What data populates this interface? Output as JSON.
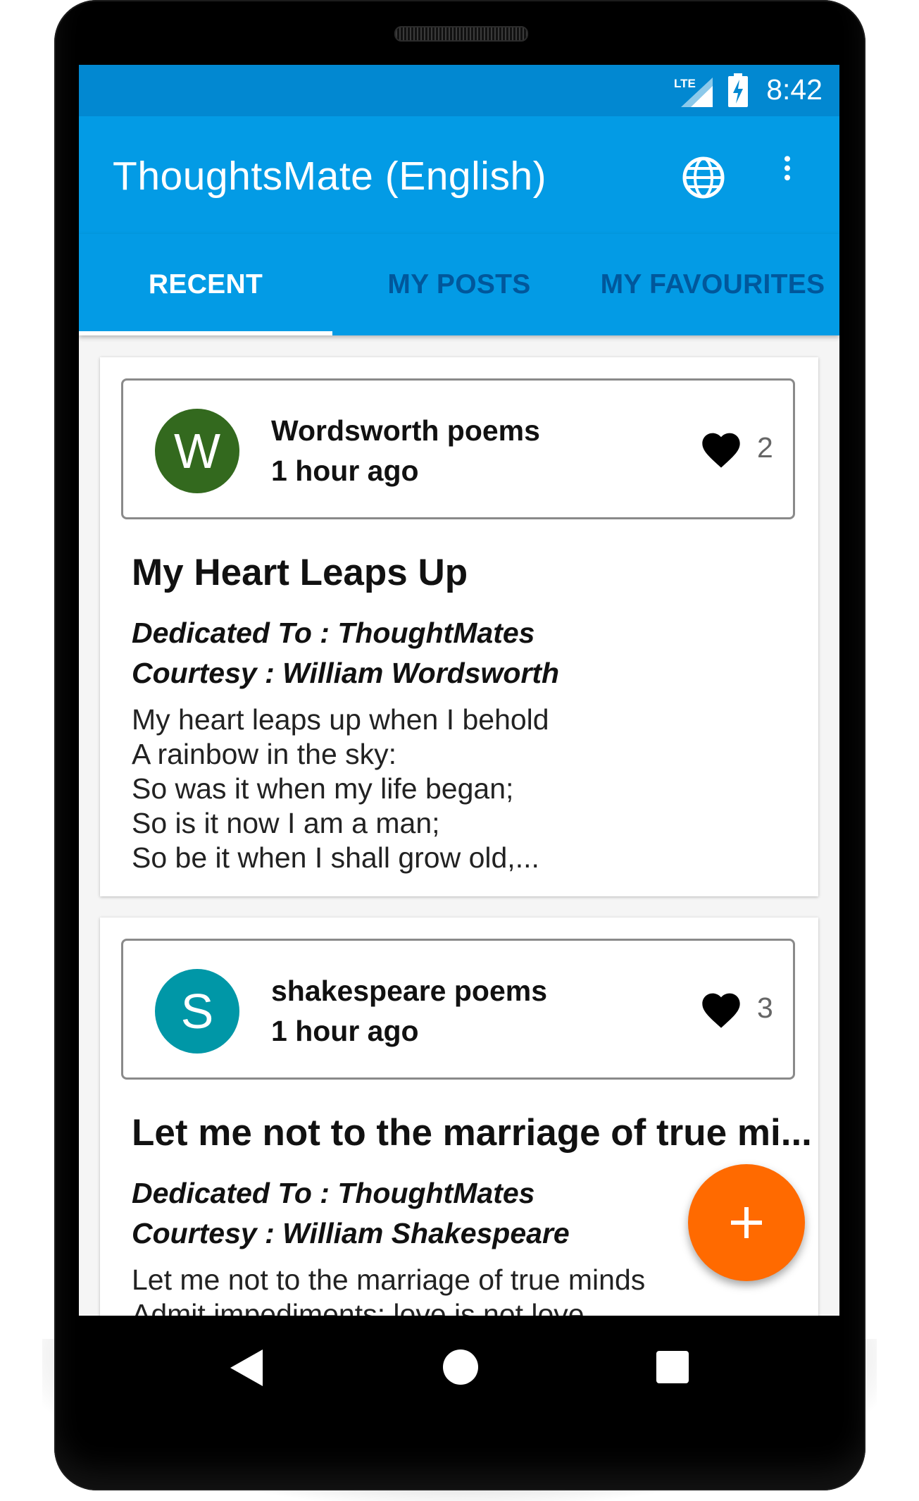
{
  "status_bar": {
    "time": "8:42",
    "network_label": "LTE",
    "network_icon": "lte-signal-icon",
    "battery_icon": "battery-charging-icon"
  },
  "app_bar": {
    "title": "ThoughtsMate (English)",
    "language_icon": "globe-icon",
    "menu_icon": "more-vert-icon"
  },
  "tabs": [
    {
      "label": "RECENT",
      "active": true
    },
    {
      "label": "MY POSTS",
      "active": false
    },
    {
      "label": "MY FAVOURITES",
      "active": false
    }
  ],
  "posts": [
    {
      "avatar_letter": "W",
      "avatar_color": "#33691e",
      "author": "Wordsworth poems",
      "time": "1 hour ago",
      "likes": "2",
      "title": "My Heart Leaps Up",
      "dedicated": "Dedicated To : ThoughtMates",
      "courtesy": "Courtesy : William Wordsworth",
      "body": "My heart leaps up when I behold\nA rainbow in the sky:\nSo was it when my life began;\nSo is it now I am a man;\nSo be it when I shall grow old,..."
    },
    {
      "avatar_letter": "S",
      "avatar_color": "#0097a7",
      "author": "shakespeare poems",
      "time": "1 hour ago",
      "likes": "3",
      "title": "Let me not to the marriage of true mi...",
      "dedicated": "Dedicated To : ThoughtMates",
      "courtesy": "Courtesy : William Shakespeare",
      "body": "Let me not to the marriage of true minds\nAdmit impediments; love is not love"
    }
  ],
  "fab": {
    "icon": "plus-icon",
    "color": "#ff6a00"
  },
  "colors": {
    "status_bar": "#0288d1",
    "app_bar": "#039be5",
    "inactive_tab": "#01579b"
  },
  "nav_bar": {
    "back_icon": "back-triangle-icon",
    "home_icon": "home-circle-icon",
    "recents_icon": "recents-square-icon"
  }
}
